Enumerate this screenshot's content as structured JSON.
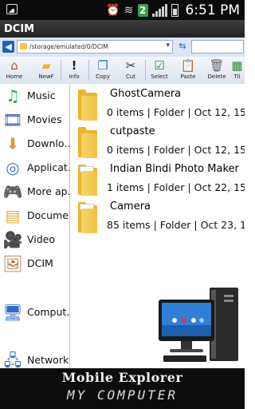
{
  "status_bar": {
    "time": "6:51 PM",
    "notification_count": "2",
    "icons": [
      "image-icon",
      "alarm-icon",
      "wifi-icon",
      "signal-icon",
      "battery-icon"
    ]
  },
  "title_bar": {
    "title": "DCIM"
  },
  "address_bar": {
    "path": "/storage/emulated/0/DCIM"
  },
  "toolbar": {
    "buttons": [
      {
        "label": "Home",
        "icon": "home-icon"
      },
      {
        "label": "NewF",
        "icon": "new-folder-icon"
      },
      {
        "label": "Info",
        "icon": "info-icon"
      },
      {
        "label": "Copy",
        "icon": "copy-icon"
      },
      {
        "label": "Cut",
        "icon": "cut-icon"
      },
      {
        "label": "Select",
        "icon": "select-icon"
      },
      {
        "label": "Paste",
        "icon": "paste-icon"
      },
      {
        "label": "Delete",
        "icon": "delete-icon"
      },
      {
        "label": "Til",
        "icon": "tile-icon"
      }
    ]
  },
  "sidebar": {
    "items": [
      {
        "label": "Music",
        "icon": "music-icon"
      },
      {
        "label": "Movies",
        "icon": "movies-icon"
      },
      {
        "label": "Downlo…",
        "icon": "download-icon"
      },
      {
        "label": "Applicat…",
        "icon": "applications-icon"
      },
      {
        "label": "More ap…",
        "icon": "gamepad-icon"
      },
      {
        "label": "Docume…",
        "icon": "documents-icon"
      },
      {
        "label": "Video",
        "icon": "video-camera-icon"
      },
      {
        "label": "DCIM",
        "icon": "photo-icon"
      },
      {
        "label": "Comput…",
        "icon": "computer-icon"
      },
      {
        "label": "Network",
        "icon": "network-icon"
      }
    ]
  },
  "folders": [
    {
      "name": "GhostCamera",
      "meta": "0 items | Folder | Oct 12, 15"
    },
    {
      "name": "cutpaste",
      "meta": "0 items | Folder | Oct 12, 15"
    },
    {
      "name": "Indian Bindi Photo Maker",
      "meta": "1 items | Folder | Oct 22, 15"
    },
    {
      "name": "Camera",
      "meta": "85 items | Folder | Oct 23, 15"
    }
  ],
  "banner": {
    "line1": "Mobile Explorer",
    "line2": "MY COMPUTER"
  },
  "colors": {
    "titlebar": "#2b2b2b",
    "toolbar": "#dbe3ee",
    "folder": "#f1c23f",
    "banner": "#0d0d0d"
  }
}
